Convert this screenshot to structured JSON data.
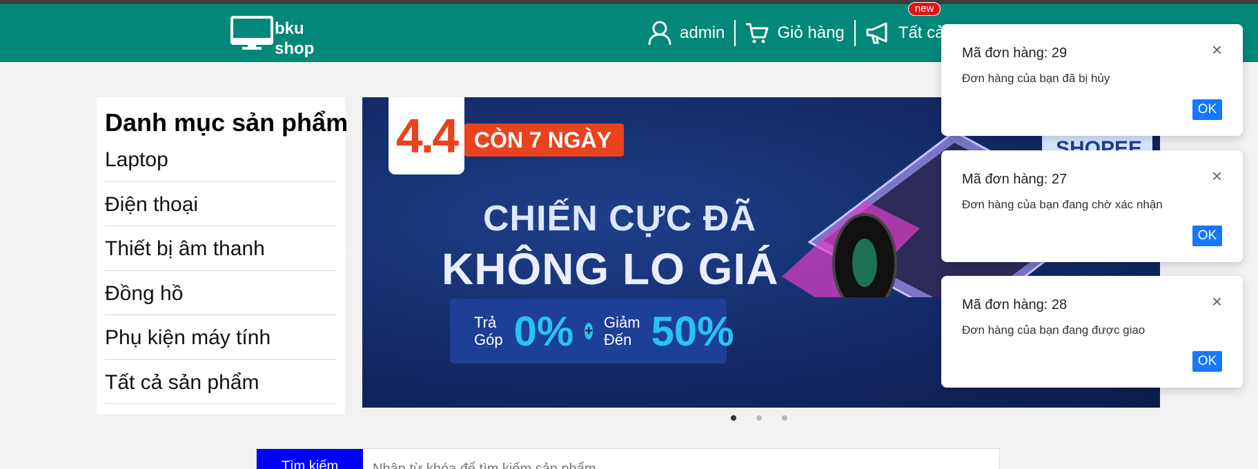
{
  "header": {
    "logo_line1": "bku",
    "logo_line2": "shop",
    "user_label": "admin",
    "cart_label": "Giỏ hàng",
    "notifications_label": "Tất cả thông báo",
    "new_badge": "new"
  },
  "sidebar": {
    "title": "Danh mục sản phẩm",
    "items": [
      {
        "label": "Laptop"
      },
      {
        "label": "Điện thoại"
      },
      {
        "label": "Thiết bị âm thanh"
      },
      {
        "label": "Đồng hồ"
      },
      {
        "label": "Phụ kiện máy tính"
      },
      {
        "label": "Tất cả sản phẩm"
      }
    ]
  },
  "banner": {
    "tag": "4.4",
    "countdown": "CÒN 7 NGÀY",
    "headline1": "CHIẾN CỰC ĐÃ",
    "headline2": "KHÔNG LO GIÁ",
    "promo1_small1": "Trả",
    "promo1_small2": "Góp",
    "promo1_big": "0%",
    "promo2_small1": "Giảm",
    "promo2_small2": "Đến",
    "promo2_big": "50%",
    "brand": "SHOPEE"
  },
  "carousel": {
    "active_index": 0,
    "count": 3
  },
  "search": {
    "button_label": "Tìm kiếm",
    "placeholder": "Nhập từ khóa để tìm kiếm sản phẩm"
  },
  "notifications": [
    {
      "title": "Mã đơn hàng: 29",
      "message": "Đơn hàng của bạn đã bị hủy",
      "ok": "OK"
    },
    {
      "title": "Mã đơn hàng: 27",
      "message": "Đơn hàng của bạn đang chờ xác nhận",
      "ok": "OK"
    },
    {
      "title": "Mã đơn hàng: 28",
      "message": "Đơn hàng của bạn đang được giao",
      "ok": "OK"
    }
  ],
  "colors": {
    "header_bg": "#02877a",
    "search_button": "#0000ff",
    "ok_button": "#1677ff",
    "badge": "#e41313"
  }
}
